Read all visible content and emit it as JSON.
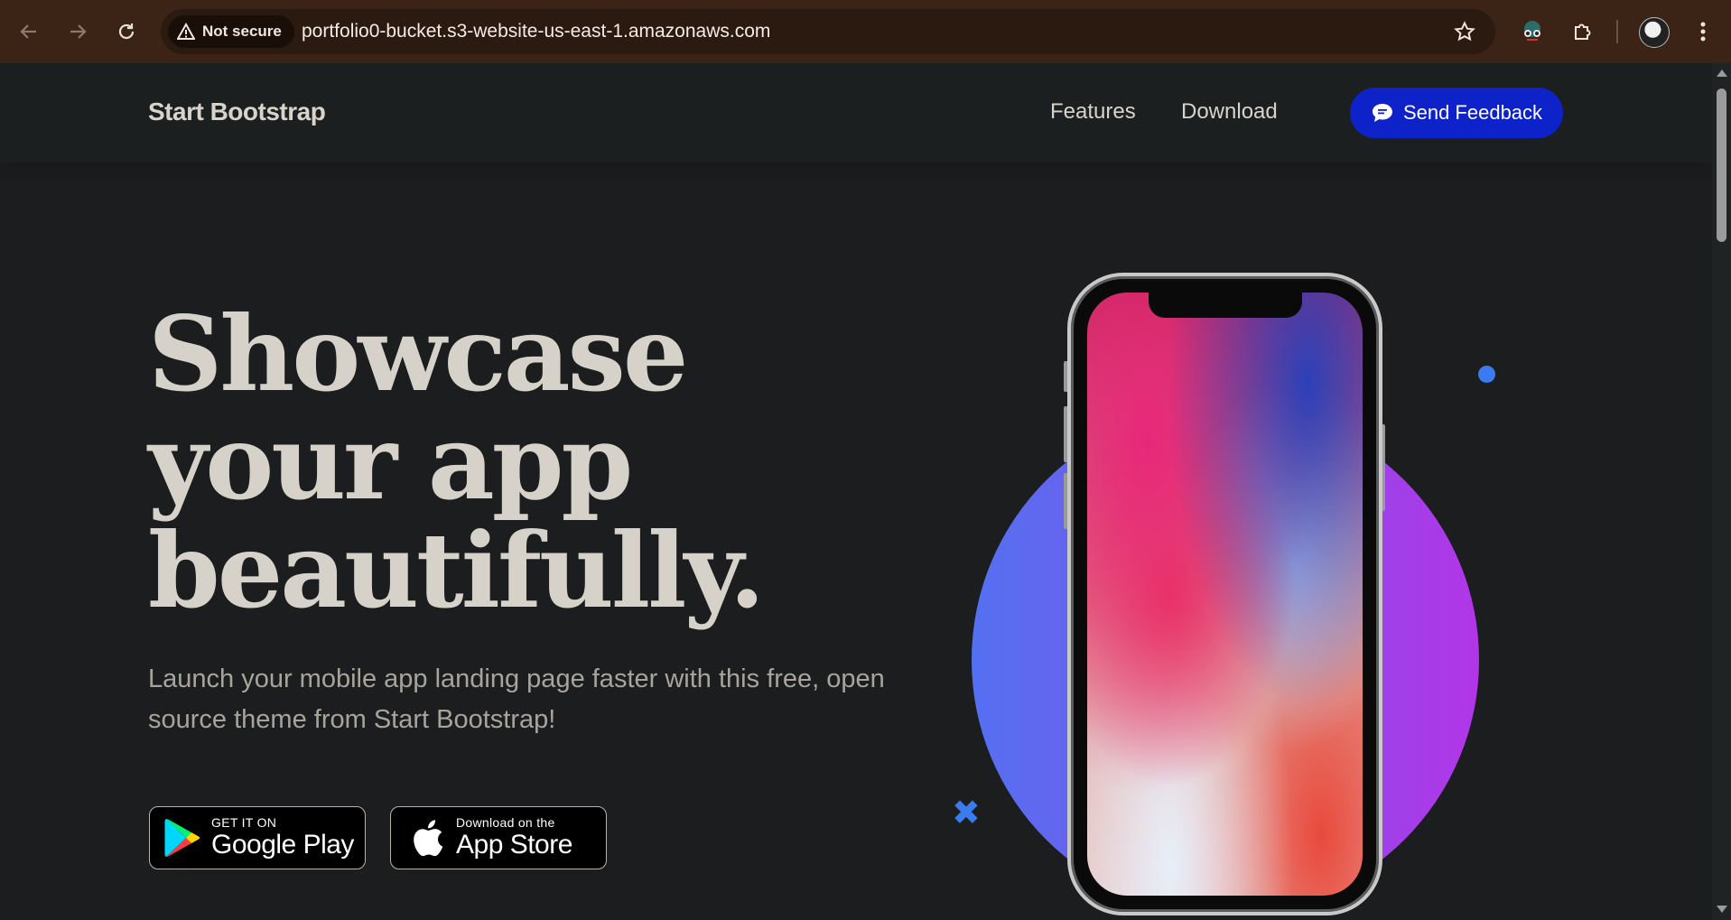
{
  "browser": {
    "security_label": "Not secure",
    "url": "portfolio0-bucket.s3-website-us-east-1.amazonaws.com"
  },
  "navbar": {
    "brand": "Start Bootstrap",
    "links": [
      "Features",
      "Download"
    ],
    "feedback_button": "Send Feedback"
  },
  "hero": {
    "headline_lines": [
      "Showcase",
      "your app",
      "beautifully."
    ],
    "lead": "Launch your mobile app landing page faster with this free, open source theme from Start Bootstrap!",
    "google_play": {
      "small": "GET IT ON",
      "big": "Google Play"
    },
    "app_store": {
      "small": "Download on the",
      "big": "App Store"
    }
  },
  "colors": {
    "accent_button": "#0d22c9",
    "circle_gradient": [
      "#5470f2",
      "#b236e8"
    ],
    "decor_blue": "#3a7cf0"
  }
}
